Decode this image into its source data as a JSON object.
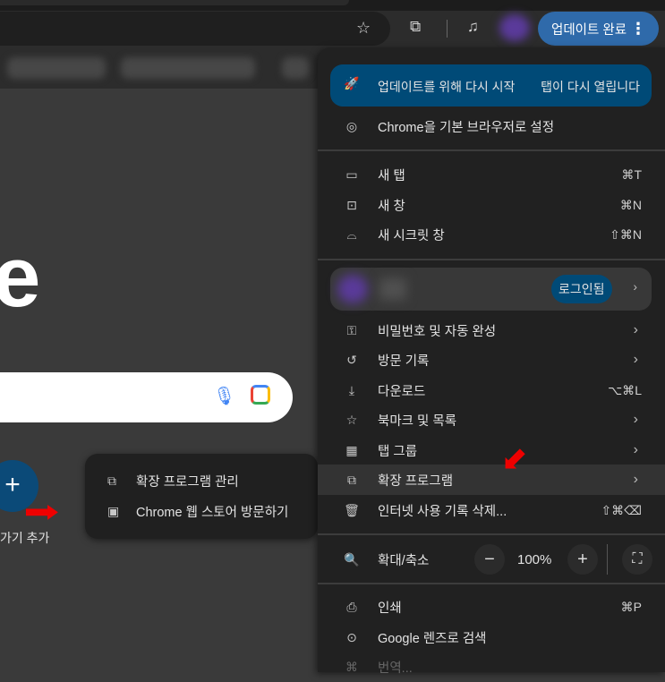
{
  "toolbar": {
    "update_button": "업데이트 완료",
    "more_icon": "⋮"
  },
  "ntp": {
    "logo_fragment": "e",
    "add_shortcut_label": "가기 추가"
  },
  "submenu": {
    "items": [
      {
        "label": "확장 프로그램 관리",
        "icon": "puzzle-icon"
      },
      {
        "label": "Chrome 웹 스토어 방문하기",
        "icon": "web-store-icon"
      }
    ]
  },
  "menu": {
    "restart": {
      "label": "업데이트를 위해 다시 시작",
      "note": "탭이 다시 열립니다"
    },
    "default_browser": "Chrome을 기본 브라우저로 설정",
    "new_tab": {
      "label": "새 탭",
      "shortcut": "⌘T"
    },
    "new_window": {
      "label": "새 창",
      "shortcut": "⌘N"
    },
    "incognito": {
      "label": "새 시크릿 창",
      "shortcut": "⇧⌘N"
    },
    "profile": {
      "badge": "로그인됨"
    },
    "passwords": "비밀번호 및 자동 완성",
    "history": "방문 기록",
    "downloads": {
      "label": "다운로드",
      "shortcut": "⌥⌘L"
    },
    "bookmarks": "북마크 및 목록",
    "tab_groups": "탭 그룹",
    "extensions": "확장 프로그램",
    "clear_data": {
      "label": "인터넷 사용 기록 삭제...",
      "shortcut": "⇧⌘⌫"
    },
    "zoom": {
      "label": "확대/축소",
      "value": "100%"
    },
    "print": {
      "label": "인쇄",
      "shortcut": "⌘P"
    },
    "lens": "Google 렌즈로 검색",
    "translate": "번역..."
  }
}
